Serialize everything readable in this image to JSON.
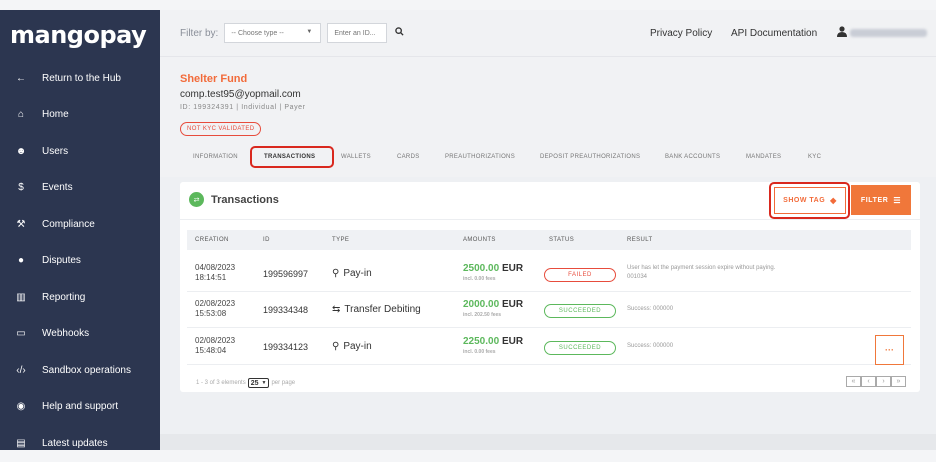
{
  "brand": {
    "logo_text": "mangopay",
    "accent": "#f26b3a",
    "sidebar_bg": "#2c3650"
  },
  "sidebar": {
    "items": [
      {
        "label": "Return to the Hub",
        "icon": "arrow-left-icon"
      },
      {
        "label": "Home",
        "icon": "home-icon"
      },
      {
        "label": "Users",
        "icon": "users-icon"
      },
      {
        "label": "Events",
        "icon": "dollar-icon"
      },
      {
        "label": "Compliance",
        "icon": "gavel-icon"
      },
      {
        "label": "Disputes",
        "icon": "alert-icon"
      },
      {
        "label": "Reporting",
        "icon": "bar-chart-icon"
      },
      {
        "label": "Webhooks",
        "icon": "laptop-icon"
      },
      {
        "label": "Sandbox operations",
        "icon": "code-icon"
      },
      {
        "label": "Help and support",
        "icon": "lifebuoy-icon"
      },
      {
        "label": "Latest updates",
        "icon": "news-icon"
      }
    ]
  },
  "topbar": {
    "filter_label": "Filter by:",
    "type_select_value": "-- Choose type --",
    "id_placeholder": "Enter an ID...",
    "privacy_link": "Privacy Policy",
    "api_link": "API Documentation"
  },
  "header": {
    "fund_name": "Shelter Fund",
    "email": "comp.test95@yopmail.com",
    "meta": "ID: 199324391  |  Individual  |  Payer",
    "kyc_badge": "NOT KYC VALIDATED",
    "tabs": [
      "INFORMATION",
      "TRANSACTIONS",
      "WALLETS",
      "CARDS",
      "PREAUTHORIZATIONS",
      "DEPOSIT PREAUTHORIZATIONS",
      "BANK ACCOUNTS",
      "MANDATES",
      "KYC"
    ],
    "active_tab": "TRANSACTIONS"
  },
  "transactions": {
    "title": "Transactions",
    "show_tag_label": "SHOW TAG",
    "filter_label": "FILTER",
    "columns": [
      "CREATION",
      "ID",
      "TYPE",
      "AMOUNTS",
      "STATUS",
      "RESULT"
    ],
    "rows": [
      {
        "date": "04/08/2023",
        "time": "18:14:51",
        "id": "199596997",
        "type": "Pay-in",
        "type_icon": "payin-icon",
        "amount": "2500.00",
        "currency": "EUR",
        "fees": "incl. 0.00 fees",
        "status": "FAILED",
        "result_line1": "User has let the payment session expire without paying.",
        "result_line2": "001034"
      },
      {
        "date": "02/08/2023",
        "time": "15:53:08",
        "id": "199334348",
        "type": "Transfer Debiting",
        "type_icon": "transfer-icon",
        "amount": "2000.00",
        "currency": "EUR",
        "fees": "incl. 202.50 fees",
        "status": "SUCCEEDED",
        "result_line1": "Success: 000000",
        "result_line2": ""
      },
      {
        "date": "02/08/2023",
        "time": "15:48:04",
        "id": "199334123",
        "type": "Pay-in",
        "type_icon": "payin-icon",
        "amount": "2250.00",
        "currency": "EUR",
        "fees": "incl. 0.00 fees",
        "status": "SUCCEEDED",
        "result_line1": "Success: 000000",
        "result_line2": ""
      }
    ],
    "pager_prefix": "1 - 3 of 3 elements",
    "page_size": "25",
    "pager_suffix": "per page",
    "pager_buttons": [
      "«",
      "‹",
      "›",
      "»"
    ],
    "row_action_label": "···"
  }
}
